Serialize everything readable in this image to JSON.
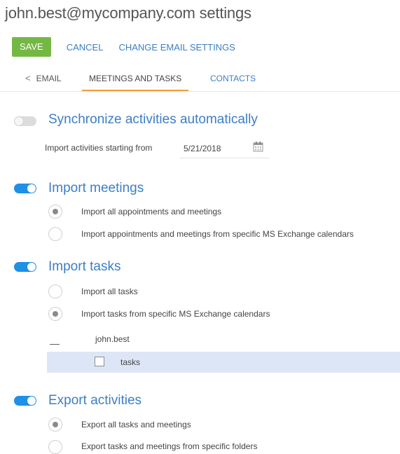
{
  "page": {
    "title": "john.best@mycompany.com settings"
  },
  "toolbar": {
    "save": "SAVE",
    "cancel": "CANCEL",
    "change_email": "CHANGE EMAIL SETTINGS"
  },
  "tabs": {
    "back_chevron": "<",
    "back": "EMAIL",
    "active": "MEETINGS AND TASKS",
    "contacts": "CONTACTS"
  },
  "sync": {
    "title": "Synchronize activities automatically",
    "enabled": false,
    "import_from_label": "Import activities starting from",
    "import_from_date": "5/21/2018",
    "calendar_icon": "calendar-icon"
  },
  "meetings": {
    "title": "Import meetings",
    "enabled": true,
    "options": [
      {
        "label": "Import all appointments and meetings",
        "checked": true
      },
      {
        "label": "Import appointments and meetings from specific MS Exchange calendars",
        "checked": false
      }
    ]
  },
  "tasks": {
    "title": "Import tasks",
    "enabled": true,
    "options": [
      {
        "label": "Import all tasks",
        "checked": false
      },
      {
        "label": "Import tasks from specific MS Exchange calendars",
        "checked": true
      }
    ],
    "tree": {
      "collapse_glyph": "—",
      "account": "john.best",
      "folder": "tasks",
      "folder_checked": false
    }
  },
  "export": {
    "title": "Export activities",
    "enabled": true,
    "options": [
      {
        "label": "Export all tasks and meetings",
        "checked": true
      },
      {
        "label": "Export tasks and meetings from specific folders",
        "checked": false
      }
    ]
  },
  "colors": {
    "accent": "#3d7ec4",
    "save": "#74b844",
    "toggle_on": "#1e90e6",
    "tab_underline": "#f39c3c",
    "selected_row": "#dde6f6"
  }
}
